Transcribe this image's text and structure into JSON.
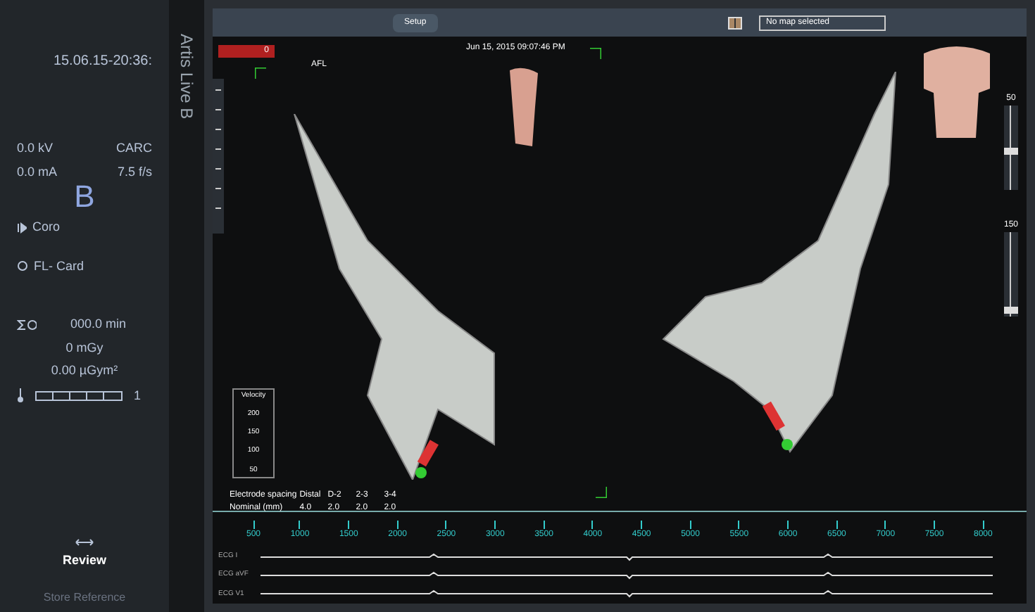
{
  "left_panel": {
    "timestamp": "15.06.15-20:36:",
    "system_name": "Artis Live B",
    "kv": "0.0 kV",
    "ma": "0.0 mA",
    "program": "CARC",
    "frame_rate": "7.5 f/s",
    "plane": "B",
    "mode": "Coro",
    "fluoro": "FL- Card",
    "time": "000.0 min",
    "dose": "0 mGy",
    "dose_area": "0.00 µGym²",
    "heat_value": "1",
    "review_button": "Review",
    "store_button": "Store Reference"
  },
  "toolbar": {
    "setup_tab": "Setup",
    "datetime": "Jun 15, 2015 09:07:46 PM",
    "map_label": "AFL",
    "dropdown_value": "0",
    "map_select": "No map selected"
  },
  "velocity_scale": {
    "title": "Velocity",
    "labels": [
      "200",
      "150",
      "100",
      "50"
    ]
  },
  "sliders": [
    {
      "label": "50",
      "level": 0.45
    },
    {
      "label": "150",
      "level": 0.04
    }
  ],
  "electrode_table": {
    "header": [
      "Electrode spacing",
      "Distal",
      "D-2",
      "2-3",
      "3-4"
    ],
    "row": [
      "Nominal (mm)",
      "4.0",
      "2.0",
      "2.0",
      "2.0"
    ]
  },
  "ruler": {
    "ticks": [
      "500",
      "1000",
      "1500",
      "2000",
      "2500",
      "3000",
      "3500",
      "4000",
      "4500",
      "5000",
      "5500",
      "6000",
      "6500",
      "7000",
      "7500",
      "8000"
    ]
  },
  "traces": [
    {
      "label": "ECG I"
    },
    {
      "label": "ECG aVF"
    },
    {
      "label": "ECG V1"
    }
  ]
}
